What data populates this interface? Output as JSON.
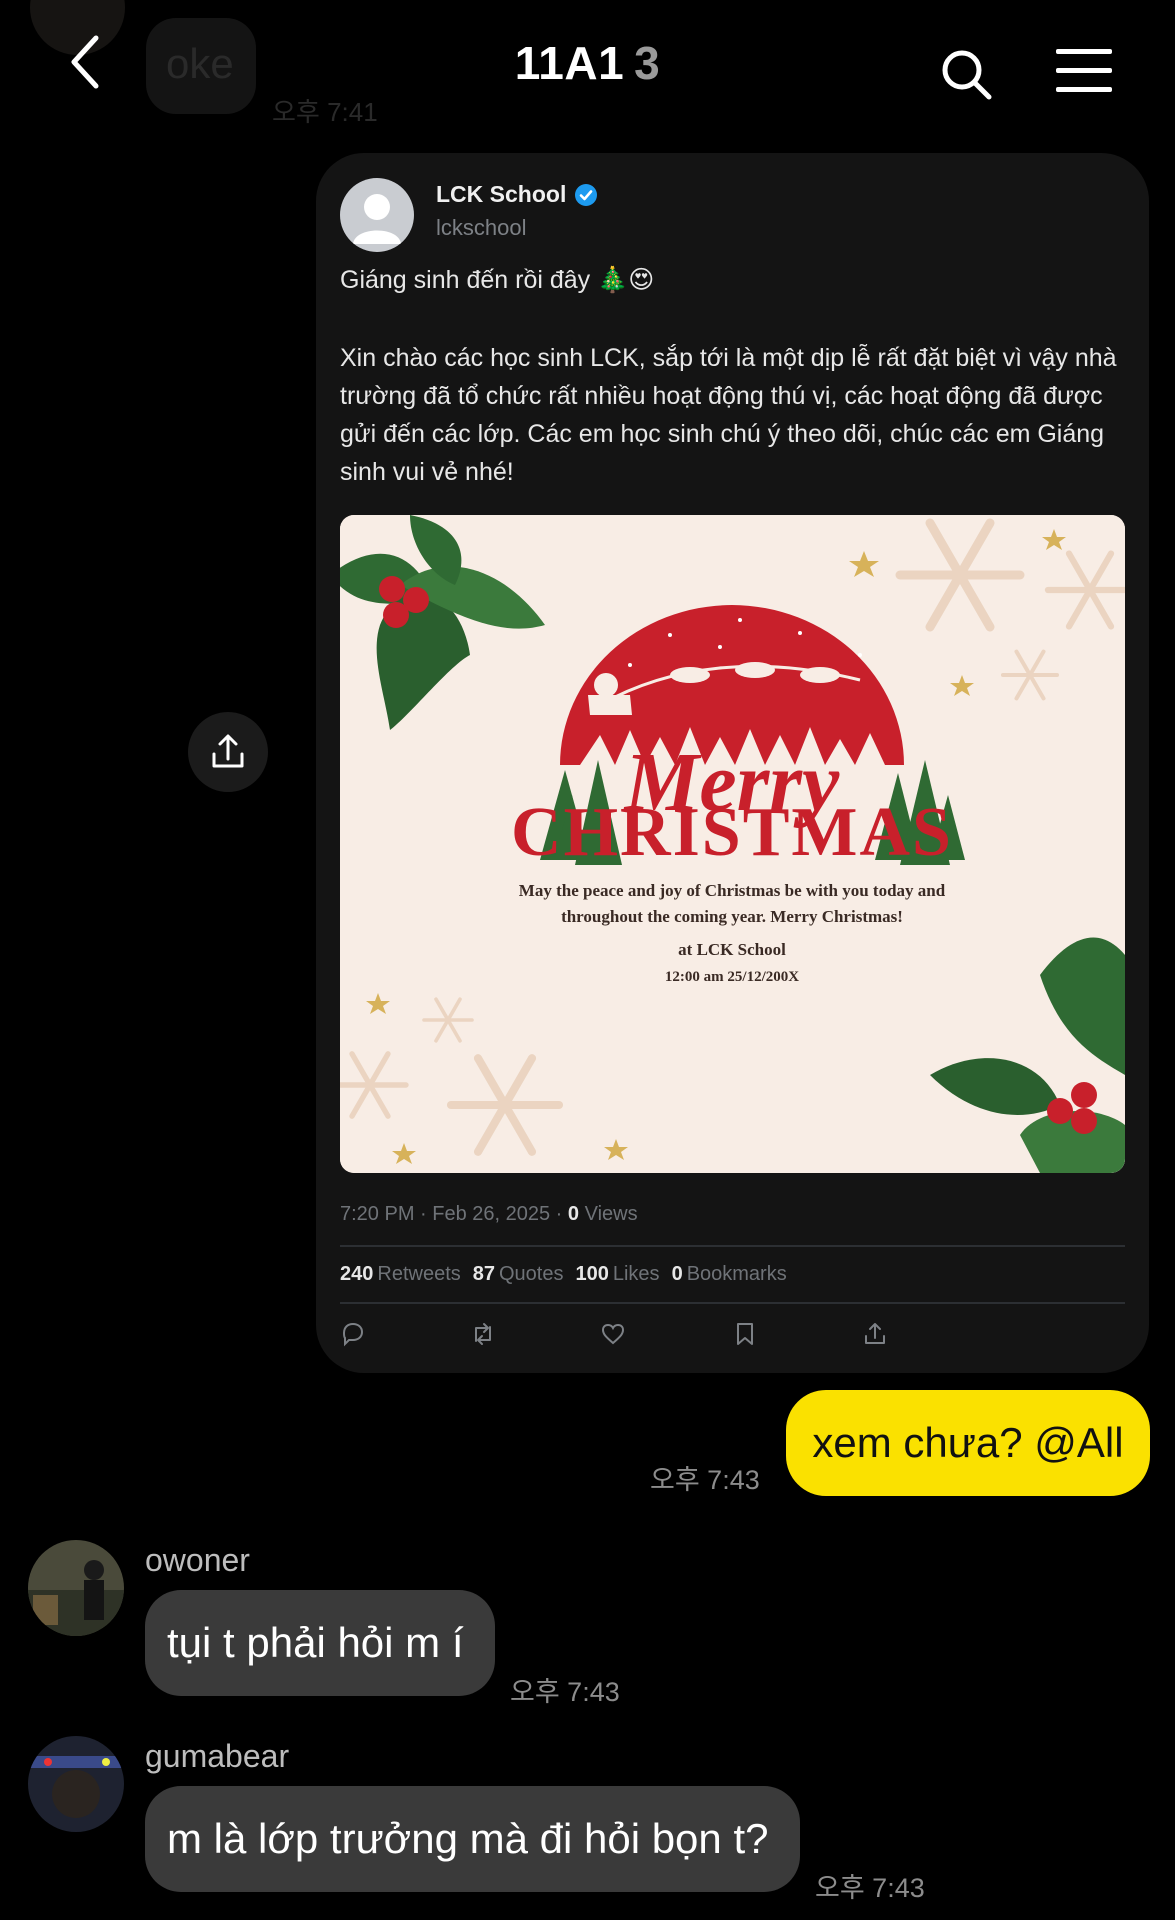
{
  "header": {
    "title": "11A1",
    "member_count": "3",
    "previous_message": "oke",
    "previous_time": "오후 7:41"
  },
  "tweet": {
    "author_name": "LCK School",
    "author_handle": "lckschool",
    "text_line1": "Giáng sinh đến rồi đây 🎄😍",
    "text_body": "Xin chào các học sinh LCK, sắp tới là một dịp lễ rất đặt biệt vì vậy nhà trường đã tổ chức rất nhiều hoạt động thú vị, các hoạt động đã được gửi đến các lớp. Các em học sinh chú ý theo dõi, chúc các em Giáng sinh vui vẻ nhé!",
    "image": {
      "merry": "Merry",
      "christmas": "CHRISTMAS",
      "message_line1": "May the peace and joy of Christmas be with you today and",
      "message_line2": "throughout the coming year. Merry Christmas!",
      "venue": "at LCK School",
      "datetime": "12:00 am 25/12/200X"
    },
    "timestamp": "7:20 PM · Feb 26, 2025 ·",
    "views_count": "0",
    "views_label": "Views",
    "stats": [
      {
        "count": "240",
        "label": "Retweets"
      },
      {
        "count": "87",
        "label": "Quotes"
      },
      {
        "count": "100",
        "label": "Likes"
      },
      {
        "count": "0",
        "label": "Bookmarks"
      }
    ]
  },
  "messages": {
    "mine": {
      "text": "xem chưa? @All",
      "time": "오후 7:43"
    },
    "reply1": {
      "sender": "owoner",
      "text": "tụi t phải hỏi m í",
      "time": "오후 7:43"
    },
    "reply2": {
      "sender": "gumabear",
      "text": "m là lớp trưởng mà đi hỏi bọn t?",
      "time": "오후 7:43"
    }
  },
  "colors": {
    "background": "#000000",
    "my_bubble": "#fae100",
    "other_bubble": "#3a3a3a",
    "verified": "#1d9bf0",
    "holiday_red": "#c8202b",
    "holiday_green": "#2f6a33"
  }
}
